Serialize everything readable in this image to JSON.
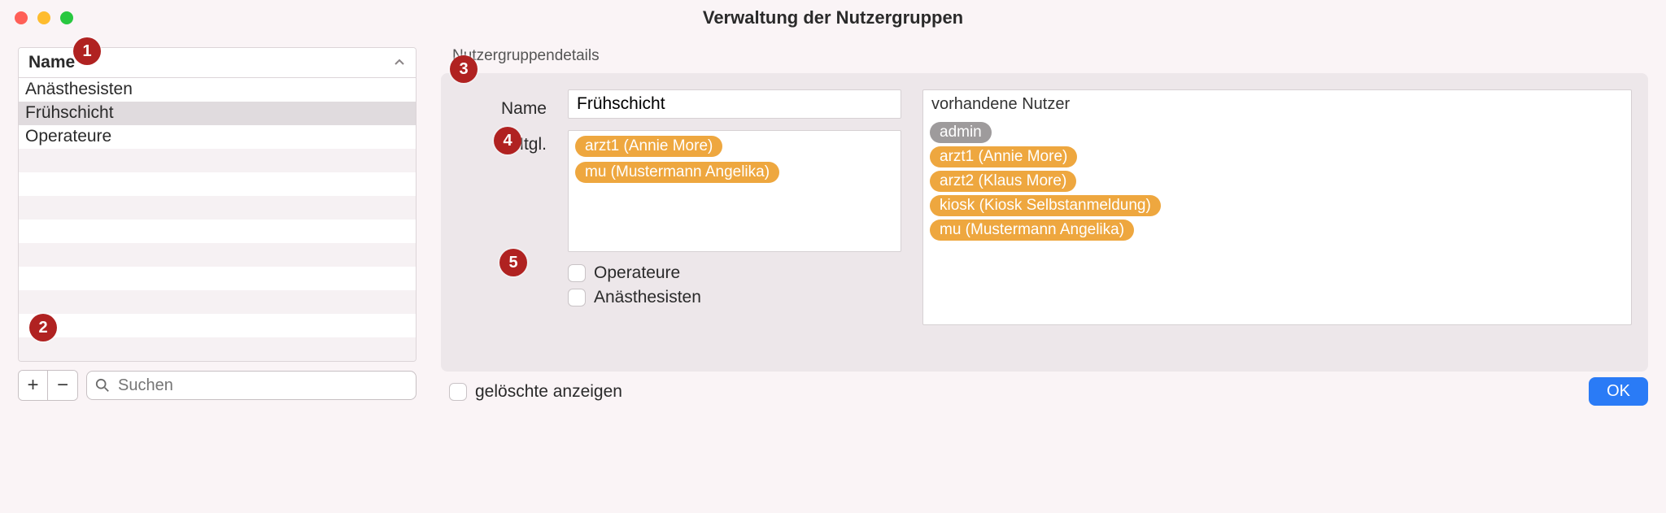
{
  "window": {
    "title": "Verwaltung der Nutzergruppen"
  },
  "table": {
    "header": "Name",
    "rows": [
      "Anästhesisten",
      "Frühschicht",
      "Operateure"
    ],
    "selected_index": 1
  },
  "toolbar": {
    "add": "+",
    "remove": "−",
    "search_placeholder": "Suchen"
  },
  "details": {
    "section_title": "Nutzergruppendetails",
    "labels": {
      "name": "Name",
      "members": "Mtgl."
    },
    "name_value": "Frühschicht",
    "members": [
      "arzt1 (Annie More)",
      "mu (Mustermann Angelika)"
    ],
    "role_checks": [
      {
        "label": "Operateure",
        "checked": false
      },
      {
        "label": "Anästhesisten",
        "checked": false
      }
    ]
  },
  "users": {
    "title": "vorhandene Nutzer",
    "list": [
      {
        "label": "admin",
        "gray": true
      },
      {
        "label": "arzt1 (Annie More)",
        "gray": false
      },
      {
        "label": "arzt2 (Klaus More)",
        "gray": false
      },
      {
        "label": "kiosk (Kiosk Selbstanmeldung)",
        "gray": false
      },
      {
        "label": "mu (Mustermann Angelika)",
        "gray": false
      }
    ]
  },
  "footer": {
    "show_deleted": "gelöschte anzeigen",
    "ok": "OK"
  },
  "callouts": [
    "1",
    "2",
    "3",
    "4",
    "5"
  ]
}
